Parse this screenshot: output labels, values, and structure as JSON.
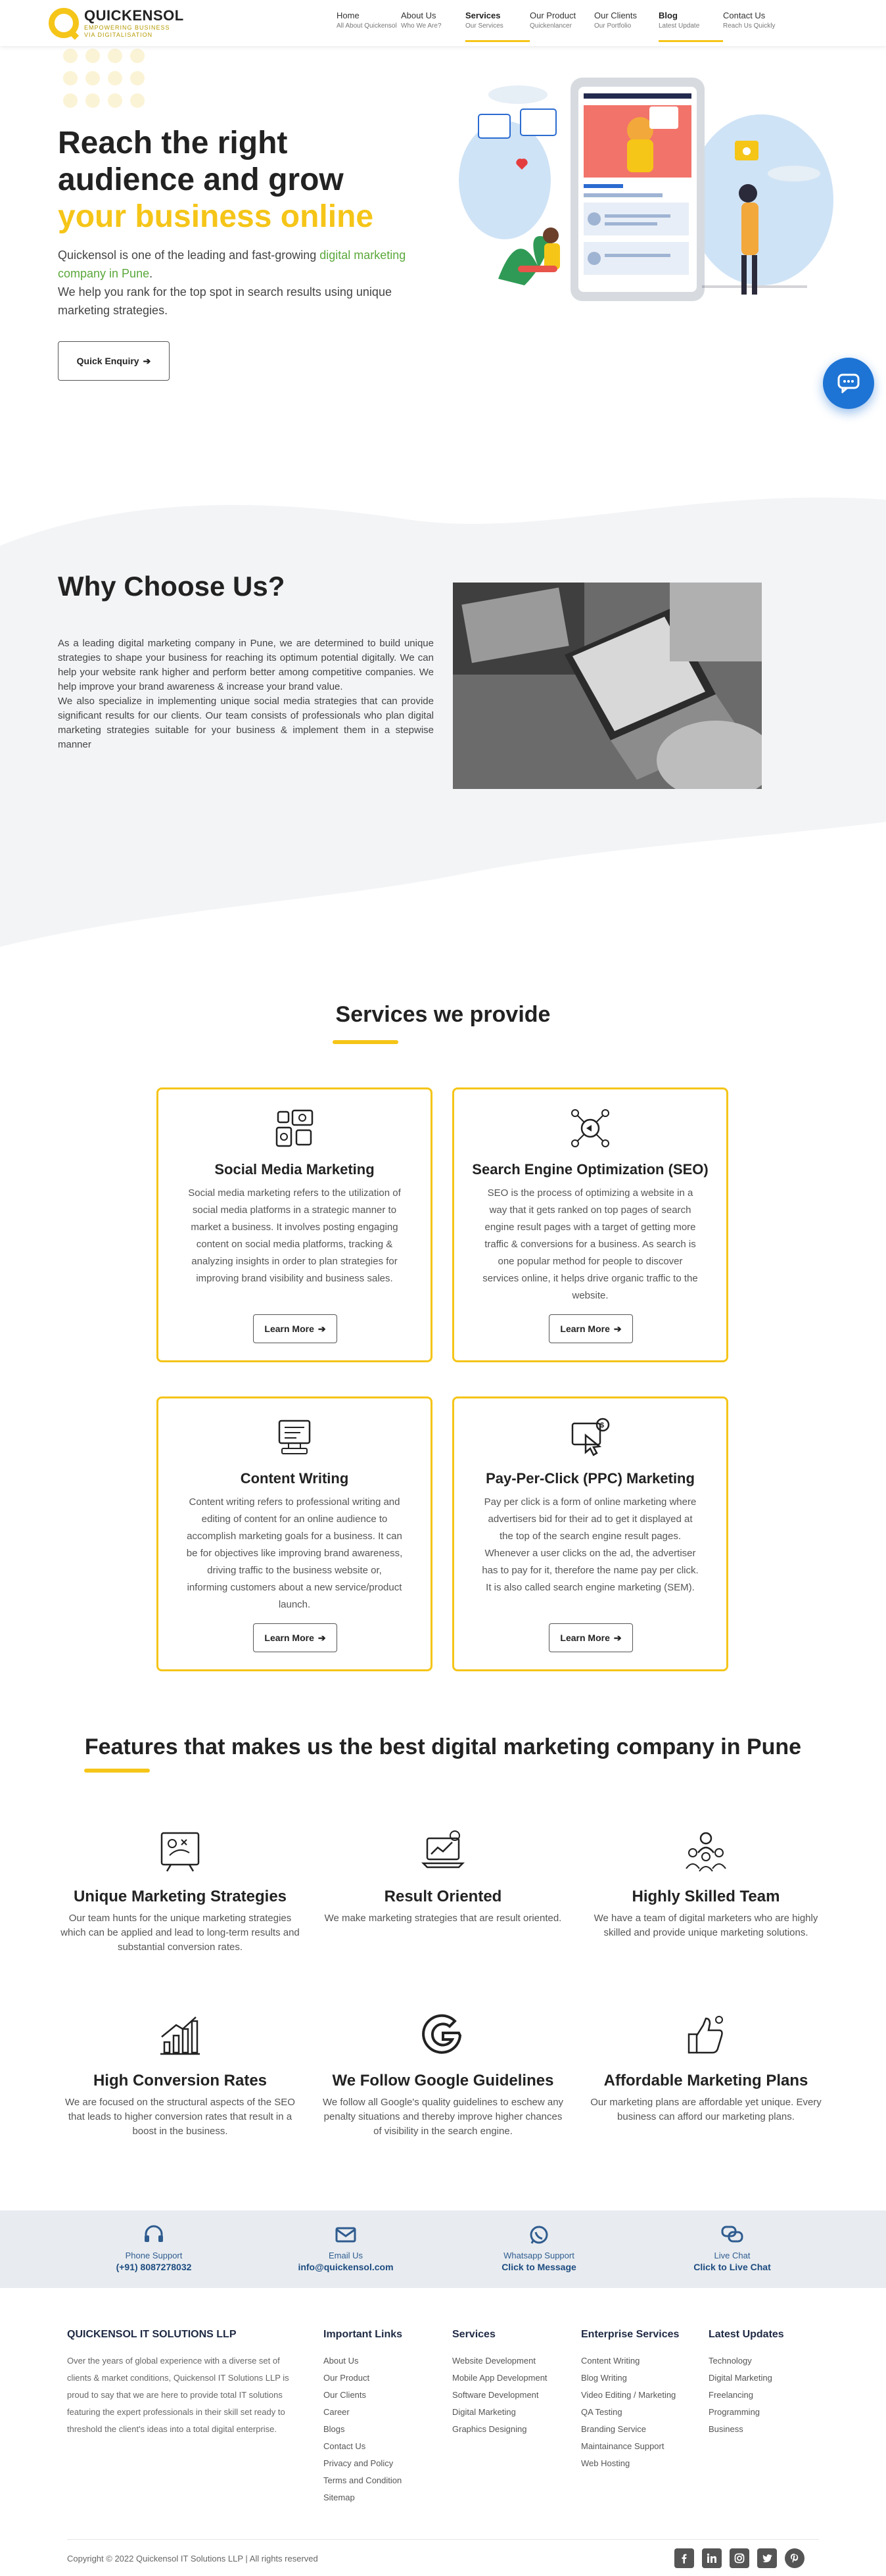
{
  "brand": {
    "name": "QUICKENSOL",
    "tagline_1": "EMPOWERING BUSINESS",
    "tagline_2": "VIA DIGITALISATION",
    "accent": "#f5c518"
  },
  "nav": [
    {
      "label": "Home",
      "sub": "All About Quickensol"
    },
    {
      "label": "About Us",
      "sub": "Who We Are?"
    },
    {
      "label": "Services",
      "sub": "Our Services"
    },
    {
      "label": "Our Product",
      "sub": "Quickenlancer"
    },
    {
      "label": "Our Clients",
      "sub": "Our Portfolio"
    },
    {
      "label": "Blog",
      "sub": "Latest Update"
    },
    {
      "label": "Contact Us",
      "sub": "Reach Us Quickly"
    }
  ],
  "hero": {
    "title_line1": "Reach the right",
    "title_line2": "audience and grow",
    "title_line3": "your business online",
    "text_1": "Quickensol is one of the leading and fast-growing ",
    "text_link": "digital marketing company in Pune",
    "text_2": ".",
    "text_3": "We help you rank for the top spot in search results using unique marketing strategies.",
    "button": "Quick Enquiry"
  },
  "why": {
    "title": "Why Choose Us?",
    "para_1": "As a leading digital marketing company in Pune, we are determined to build unique strategies to shape your business for reaching its optimum potential digitally. We can help your website rank higher and perform better among competitive companies. We help improve your brand awareness & increase your brand value.",
    "para_2": "We also specialize in implementing unique social media strategies that can provide significant results for our clients. Our team consists of professionals who plan digital marketing strategies suitable for your business & implement them in a stepwise manner"
  },
  "services": {
    "title": "Services we provide",
    "button": "Learn More",
    "items": [
      {
        "title": "Social Media Marketing",
        "desc": "Social media marketing refers to the utilization of social media platforms in a strategic manner to market a business. It involves posting engaging content on social media platforms, tracking & analyzing insights in order to plan strategies for improving brand visibility and business sales."
      },
      {
        "title": "Search Engine Optimization (SEO)",
        "desc": "SEO is the process of optimizing a website in a way that it gets ranked on top pages of search engine result pages with a target of getting more traffic & conversions for a business. As search is one popular method for people to discover services online, it helps drive organic traffic to the website."
      },
      {
        "title": "Content Writing",
        "desc": "Content writing refers to professional writing and editing of content for an online audience to accomplish marketing goals for a business. It can be for objectives like improving brand awareness, driving traffic to the business website or, informing customers about a new service/product launch."
      },
      {
        "title": "Pay-Per-Click (PPC) Marketing",
        "desc": "Pay per click is a form of online marketing where advertisers bid for their ad to get it displayed at the top of the search engine result pages. Whenever a user clicks on the ad, the advertiser has to pay for it, therefore the name pay per click. It is also called search engine marketing (SEM)."
      }
    ]
  },
  "features": {
    "title": "Features that makes us the best digital marketing company in Pune",
    "items": [
      {
        "title": "Unique Marketing Strategies",
        "desc": "Our team hunts for the unique marketing strategies which can be applied and lead to long-term results and substantial conversion rates."
      },
      {
        "title": "Result Oriented",
        "desc": "We make marketing strategies that are result oriented."
      },
      {
        "title": "Highly Skilled Team",
        "desc": "We have a team of digital marketers who are highly skilled and provide unique marketing solutions."
      },
      {
        "title": "High Conversion Rates",
        "desc": "We are focused on the structural aspects of the SEO that leads to higher conversion rates that result in a boost in the business."
      },
      {
        "title": "We Follow Google Guidelines",
        "desc": "We follow all Google's quality guidelines to eschew any penalty situations and thereby improve higher chances of visibility in the search engine."
      },
      {
        "title": "Affordable Marketing Plans",
        "desc": "Our marketing plans are affordable yet unique. Every business can afford our marketing plans."
      }
    ]
  },
  "contacts": [
    {
      "label": "Phone Support",
      "value": "(+91) 8087278032",
      "icon": "headset-icon"
    },
    {
      "label": "Email Us",
      "value": "info@quickensol.com",
      "icon": "envelope-icon"
    },
    {
      "label": "Whatsapp Support",
      "value": "Click to Message",
      "icon": "whatsapp-icon"
    },
    {
      "label": "Live Chat",
      "value": "Click to Live Chat",
      "icon": "chat-bubbles-icon"
    }
  ],
  "footer": {
    "company": {
      "title": "QUICKENSOL IT SOLUTIONS LLP",
      "about": "Over the years of global experience with a diverse set of clients & market conditions, Quickensol IT Solutions LLP is proud to say that we are here to provide total IT solutions featuring the expert professionals in their skill set ready to threshold the client's ideas into a total digital enterprise."
    },
    "columns": [
      {
        "title": "Important Links",
        "items": [
          "About Us",
          "Our Product",
          "Our Clients",
          "Career",
          "Blogs",
          "Contact Us",
          "Privacy and Policy",
          "Terms and Condition",
          "Sitemap"
        ]
      },
      {
        "title": "Services",
        "items": [
          "Website Development",
          "Mobile App Development",
          "Software Development",
          "Digital Marketing",
          "Graphics Designing"
        ]
      },
      {
        "title": "Enterprise Services",
        "items": [
          "Content Writing",
          "Blog Writing",
          "Video Editing / Marketing",
          "QA Testing",
          "Branding Service",
          "Maintainance Support",
          "Web Hosting"
        ]
      },
      {
        "title": "Latest Updates",
        "items": [
          "Technology",
          "Digital Marketing",
          "Freelancing",
          "Programming",
          "Business"
        ]
      }
    ],
    "copyright": "Copyright © 2022 Quickensol IT Solutions LLP | All rights reserved",
    "social": [
      "facebook-icon",
      "linkedin-icon",
      "instagram-icon",
      "twitter-icon",
      "pinterest-icon"
    ]
  }
}
